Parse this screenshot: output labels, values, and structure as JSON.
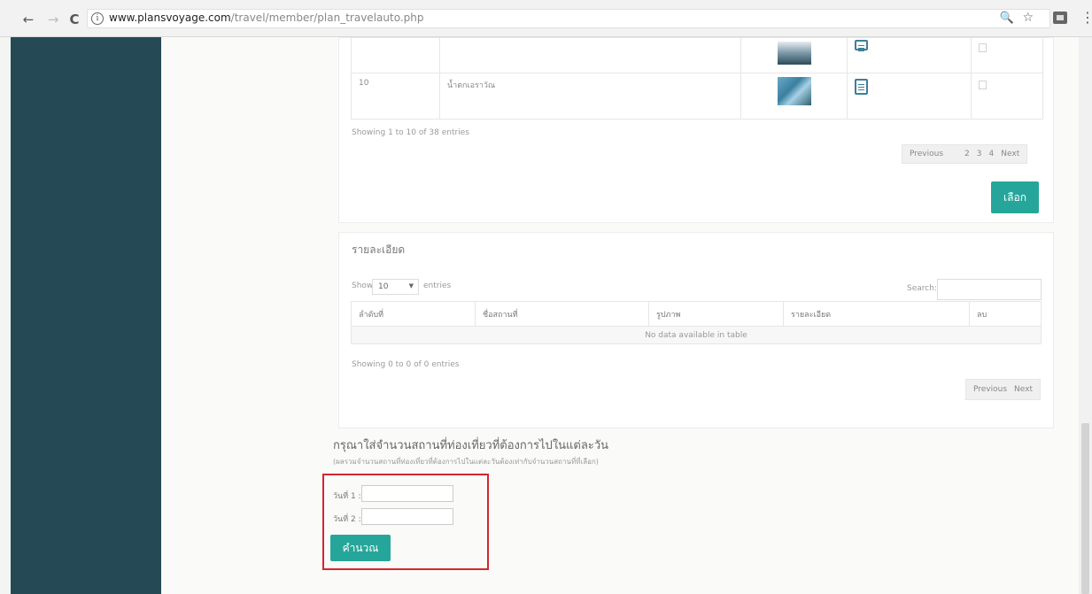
{
  "browser": {
    "back_icon": "←",
    "forward_icon": "→",
    "reload_icon": "C",
    "info_icon": "i",
    "url_host": "www.plansvoyage.com",
    "url_path": "/travel/member/plan_travelauto.php",
    "zoom_icon": "🔍",
    "star_icon": "☆",
    "menu_icon": "⋮"
  },
  "places_table": {
    "rows": [
      {
        "no": "",
        "name": ""
      },
      {
        "no": "10",
        "name": "น้ำตกเอราวัณ"
      }
    ],
    "info": "Showing 1 to 10 of 38 entries",
    "pager": {
      "previous": "Previous",
      "p2": "2",
      "p3": "3",
      "p4": "4",
      "next": "Next"
    },
    "select_button": "เลือก"
  },
  "details": {
    "title": "รายละเอียด",
    "show_label": "Show",
    "show_value": "10",
    "entries_label": "entries",
    "search_label": "Search:",
    "columns": [
      "ลำดับที่",
      "ชื่อสถานที่",
      "รูปภาพ",
      "รายละเอียด",
      "ลบ"
    ],
    "empty": "No data available in table",
    "info": "Showing 0 to 0 of 0 entries",
    "pager": {
      "previous": "Previous",
      "next": "Next"
    }
  },
  "per_day": {
    "heading": "กรุณาใส่จำนวนสถานที่ท่องเที่ยวที่ต้องการไปในแต่ละวัน",
    "hint": "(ผลรวมจำนวนสถานที่ท่องเที่ยวที่ต้องการไปในแต่ละวันต้องเท่ากับจำนวนสถานที่ที่เลือก)",
    "day1_label": "วันที่ 1 :",
    "day2_label": "วันที่ 2 :",
    "calculate_button": "คำนวณ"
  },
  "colors": {
    "sidebar": "#254a55",
    "accent": "#26a69a",
    "highlight": "#d22730"
  }
}
